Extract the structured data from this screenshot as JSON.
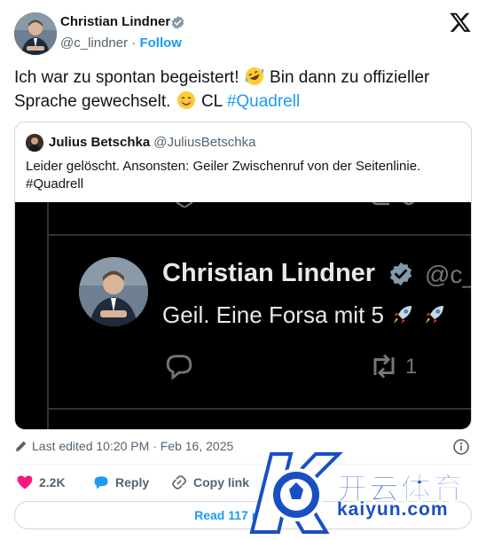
{
  "author": {
    "name": "Christian Lindner",
    "handle": "@c_lindner",
    "separator": "·",
    "follow_label": "Follow"
  },
  "tweet": {
    "text_part1": "Ich war zu spontan begeistert! ",
    "text_part2": " Bin dann zu offizieller Sprache gewechselt. ",
    "text_part3": " CL ",
    "hashtag": "#Quadrell"
  },
  "quote": {
    "name": "Julius Betschka",
    "handle": "@JuliusBetschka",
    "text": "Leider gelöscht. Ansonsten: Geiler Zwischenruf von der Seitenlinie.",
    "hashtag": "#Quadrell",
    "media": {
      "name": "Christian Lindner",
      "handle": "@c_",
      "text": "Geil. Eine Forsa mit 5",
      "retweet_count": "1"
    }
  },
  "meta": {
    "edited": "Last edited 10:20 PM · Feb 16, 2025"
  },
  "actions": {
    "likes": "2.2K",
    "reply_label": "Reply",
    "copy_label": "Copy link"
  },
  "read_replies_label": "Read 117 replies",
  "watermark": {
    "text_cn": "开云体育",
    "text_latin": "kaiyun.com"
  },
  "colors": {
    "accent": "#1d9bf0",
    "like": "#f91880",
    "text": "#0f1419",
    "muted": "#536471"
  },
  "icons": [
    "verified-badge-icon",
    "x-logo-icon",
    "rofl-emoji-icon",
    "smiling-emoji-icon",
    "pencil-icon",
    "info-icon",
    "heart-icon",
    "reply-bubble-icon",
    "link-icon",
    "rocket-emoji-icon",
    "retweet-icon"
  ]
}
